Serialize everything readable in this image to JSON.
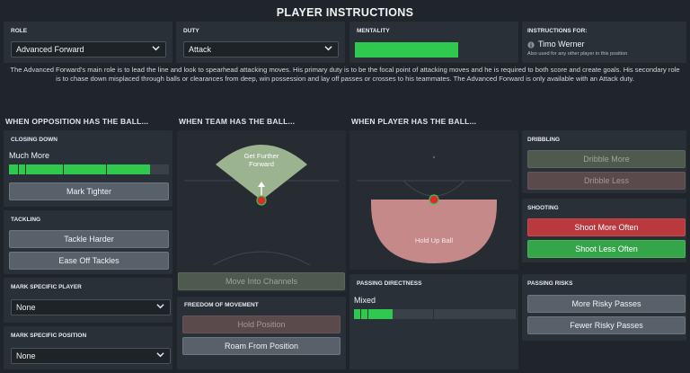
{
  "title": "PLAYER INSTRUCTIONS",
  "role": {
    "label": "ROLE",
    "value": "Advanced Forward"
  },
  "duty": {
    "label": "DUTY",
    "value": "Attack"
  },
  "mentality": {
    "label": "MENTALITY",
    "level": 1.0,
    "color": "#2fc950"
  },
  "instructions_for": {
    "label": "INSTRUCTIONS FOR:",
    "player": "Timo Werner",
    "note": "Also used for any other player in this position",
    "icon": "info-icon"
  },
  "description": "The Advanced Forward's main role is to lead the line and look to spearhead attacking moves. His primary duty is to be the focal point of attacking moves and he is required to both score and create goals. His secondary role is to chase down misplaced through balls or clearances from deep, win possession and lay off passes or crosses to his teammates. The Advanced Forward is only available with an Attack duty.",
  "sections": {
    "opposition": "WHEN OPPOSITION HAS THE BALL...",
    "team": "WHEN TEAM HAS THE BALL...",
    "player": "WHEN PLAYER HAS THE BALL..."
  },
  "closing_down": {
    "label": "CLOSING DOWN",
    "value": "Much More",
    "level": 0.88,
    "button": "Mark Tighter"
  },
  "tackling": {
    "label": "TACKLING",
    "buttons": [
      "Tackle Harder",
      "Ease Off Tackles"
    ]
  },
  "mark_player": {
    "label": "MARK SPECIFIC PLAYER",
    "value": "None"
  },
  "mark_position": {
    "label": "MARK SPECIFIC POSITION",
    "value": "None"
  },
  "team_pitch": {
    "zone_label": "Get Further Forward",
    "button": "Move Into Channels"
  },
  "freedom": {
    "label": "FREEDOM OF MOVEMENT",
    "buttons": [
      "Hold Position",
      "Roam From Position"
    ]
  },
  "player_pitch": {
    "zone_label": "Hold Up Ball"
  },
  "passing_directness": {
    "label": "PASSING DIRECTNESS",
    "value": "Mixed",
    "level": 0.24
  },
  "dribbling": {
    "label": "DRIBBLING",
    "buttons": [
      "Dribble More",
      "Dribble Less"
    ]
  },
  "shooting": {
    "label": "SHOOTING",
    "buttons": [
      "Shoot More Often",
      "Shoot Less Often"
    ]
  },
  "passing_risks": {
    "label": "PASSING RISKS",
    "buttons": [
      "More Risky Passes",
      "Fewer Risky Passes"
    ]
  },
  "colors": {
    "accent_green": "#2fc950",
    "red_button": "#b9393e",
    "green_button": "#35a54a",
    "player_marker": "#e02a2a"
  }
}
